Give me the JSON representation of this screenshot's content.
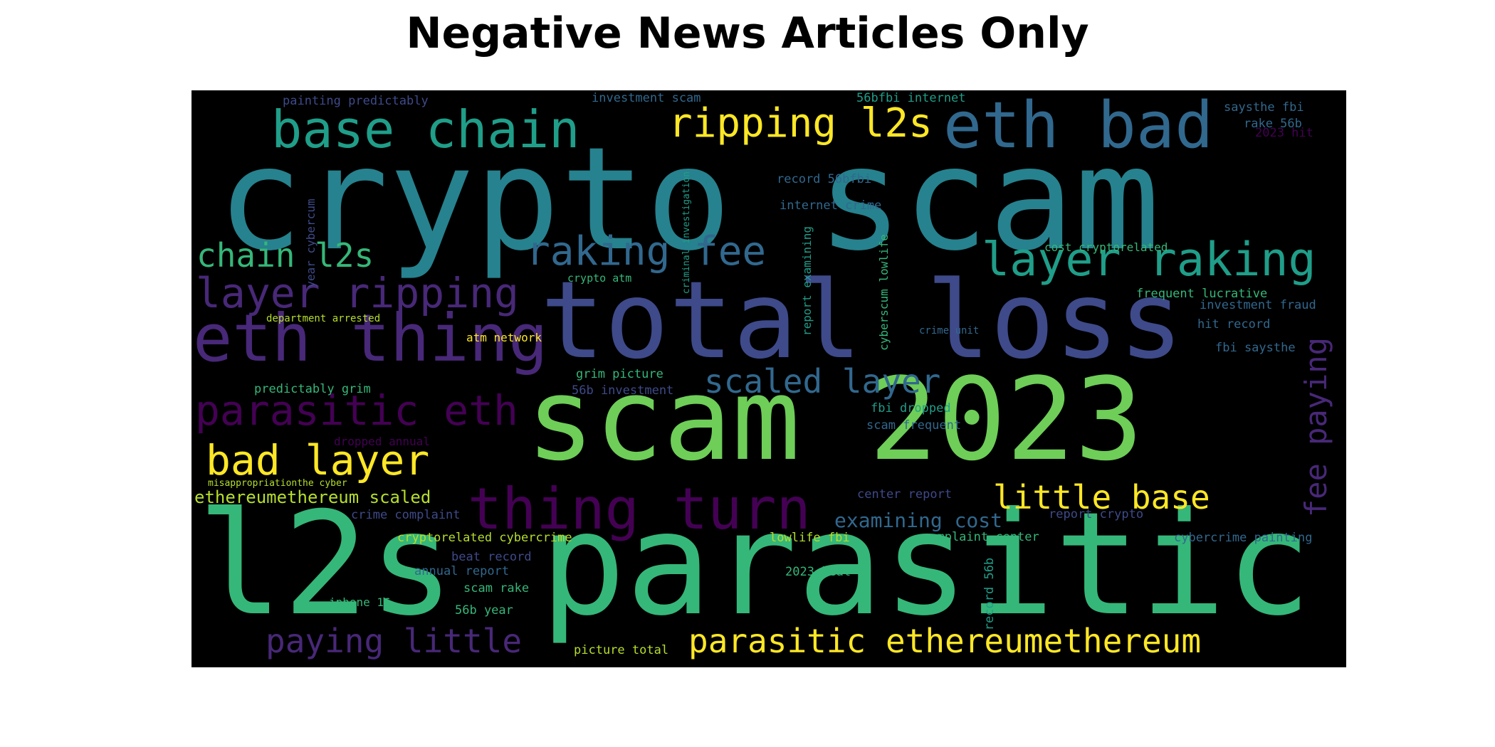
{
  "title": "Negative News Articles Only",
  "background_color": "#000000",
  "palette": {
    "indigo": "#482878",
    "purple": "#440154",
    "slate": "#3e4a89",
    "steelblue": "#31688e",
    "teal": "#26828e",
    "green": "#35b779",
    "sea": "#1f9e89",
    "lime": "#6ece58",
    "yellow": "#fde725",
    "gold": "#b5de2b"
  },
  "words": [
    {
      "text": "crypto scam",
      "color": "teal"
    },
    {
      "text": "total loss",
      "color": "slate"
    },
    {
      "text": "scam 2023",
      "color": "lime"
    },
    {
      "text": "l2s parasitic",
      "color": "green"
    },
    {
      "text": "eth bad",
      "color": "steelblue"
    },
    {
      "text": "base chain",
      "color": "sea"
    },
    {
      "text": "ripping l2s",
      "color": "yellow"
    },
    {
      "text": "raking fee",
      "color": "steelblue"
    },
    {
      "text": "layer raking",
      "color": "sea"
    },
    {
      "text": "chain l2s",
      "color": "green"
    },
    {
      "text": "layer ripping",
      "color": "indigo"
    },
    {
      "text": "eth thing",
      "color": "indigo"
    },
    {
      "text": "scaled layer",
      "color": "steelblue"
    },
    {
      "text": "parasitic eth",
      "color": "purple"
    },
    {
      "text": "bad layer",
      "color": "yellow"
    },
    {
      "text": "thing turn",
      "color": "purple"
    },
    {
      "text": "little base",
      "color": "yellow"
    },
    {
      "text": "ethereumethereum scaled",
      "color": "gold"
    },
    {
      "text": "examining cost",
      "color": "steelblue"
    },
    {
      "text": "paying little",
      "color": "indigo"
    },
    {
      "text": "parasitic ethereumethereum",
      "color": "yellow"
    },
    {
      "text": "fee paying",
      "color": "indigo"
    },
    {
      "text": "painting predictably",
      "color": "slate"
    },
    {
      "text": "investment scam",
      "color": "steelblue"
    },
    {
      "text": "56bfbi internet",
      "color": "sea"
    },
    {
      "text": "saysthe fbi",
      "color": "steelblue"
    },
    {
      "text": "rake 56b",
      "color": "steelblue"
    },
    {
      "text": "2023 hit",
      "color": "purple"
    },
    {
      "text": "record 56bfbi",
      "color": "steelblue"
    },
    {
      "text": "internet crime",
      "color": "steelblue"
    },
    {
      "text": "cost cryptorelated",
      "color": "green"
    },
    {
      "text": "frequent lucrative",
      "color": "green"
    },
    {
      "text": "investment fraud",
      "color": "steelblue"
    },
    {
      "text": "hit record",
      "color": "steelblue"
    },
    {
      "text": "fbi saysthe",
      "color": "steelblue"
    },
    {
      "text": "crypto atm",
      "color": "green"
    },
    {
      "text": "department arrested",
      "color": "gold"
    },
    {
      "text": "atm network",
      "color": "yellow"
    },
    {
      "text": "crime unit",
      "color": "steelblue"
    },
    {
      "text": "grim picture",
      "color": "green"
    },
    {
      "text": "predictably grim",
      "color": "green"
    },
    {
      "text": "56b investment",
      "color": "slate"
    },
    {
      "text": "fbi dropped",
      "color": "sea"
    },
    {
      "text": "scam frequent",
      "color": "steelblue"
    },
    {
      "text": "dropped annual",
      "color": "purple"
    },
    {
      "text": "misappropriationthe cyber",
      "color": "gold"
    },
    {
      "text": "center report",
      "color": "slate"
    },
    {
      "text": "report crypto",
      "color": "slate"
    },
    {
      "text": "crime complaint",
      "color": "slate"
    },
    {
      "text": "cryptorelated cybercrime",
      "color": "gold"
    },
    {
      "text": "lowlife fbi",
      "color": "gold"
    },
    {
      "text": "complaint center",
      "color": "green"
    },
    {
      "text": "cybercrime painting",
      "color": "steelblue"
    },
    {
      "text": "beat record",
      "color": "slate"
    },
    {
      "text": "annual report",
      "color": "steelblue"
    },
    {
      "text": "2023 beat",
      "color": "green"
    },
    {
      "text": "scam rake",
      "color": "green"
    },
    {
      "text": "iphone 16",
      "color": "green"
    },
    {
      "text": "56b year",
      "color": "green"
    },
    {
      "text": "picture total",
      "color": "gold"
    },
    {
      "text": "year cybercum",
      "color": "slate"
    },
    {
      "text": "criminal investigation",
      "color": "sea"
    },
    {
      "text": "report examining",
      "color": "sea"
    },
    {
      "text": "cyberscum lowlife",
      "color": "green"
    },
    {
      "text": "record 56b",
      "color": "sea"
    }
  ]
}
